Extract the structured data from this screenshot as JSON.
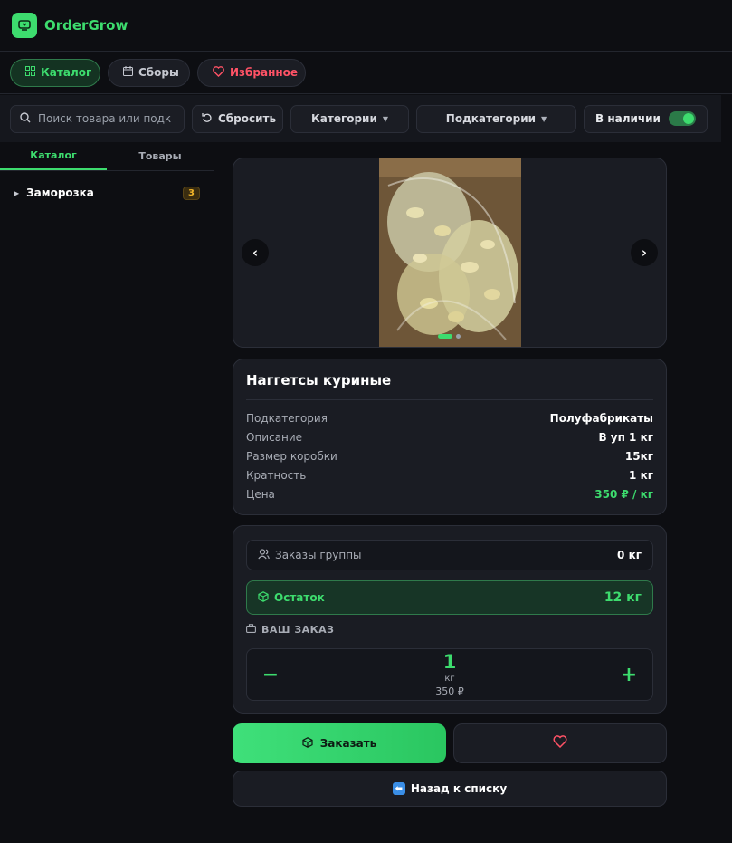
{
  "app": {
    "name": "OrderGrow"
  },
  "nav": {
    "catalog": "Каталог",
    "collections": "Сборы",
    "favorites": "Избранное"
  },
  "filters": {
    "search_placeholder": "Поиск товара или подк",
    "reset": "Сбросить",
    "categories": "Категории",
    "subcategories": "Подкатегории",
    "in_stock": "В наличии",
    "in_stock_on": true
  },
  "sidebar": {
    "tabs": [
      "Каталог",
      "Товары"
    ],
    "items": [
      {
        "label": "Заморозка",
        "count": "3"
      }
    ]
  },
  "gallery": {
    "slide_count": 2,
    "active_slide": 1
  },
  "product": {
    "title": "Наггетсы куриные",
    "rows": [
      {
        "key": "Подкатегория",
        "value": "Полуфабрикаты"
      },
      {
        "key": "Описание",
        "value": "В уп 1 кг"
      },
      {
        "key": "Размер коробки",
        "value": "15кг"
      },
      {
        "key": "Кратность",
        "value": "1 кг"
      },
      {
        "key": "Цена",
        "value": "350 ₽ / кг"
      }
    ]
  },
  "order": {
    "group_orders_label": "Заказы группы",
    "group_orders_value": "0 кг",
    "remaining_label": "Остаток",
    "remaining_value": "12 кг",
    "your_order_label": "ВАШ ЗАКАЗ",
    "quantity": "1",
    "unit": "кг",
    "total": "350 ₽",
    "minus": "−",
    "plus": "+"
  },
  "actions": {
    "order": "Заказать",
    "back": "Назад к списку"
  },
  "colors": {
    "accent": "#3ddc6e",
    "favorite": "#ff5266",
    "badge": "#f0b429",
    "background": "#0d0e12"
  }
}
